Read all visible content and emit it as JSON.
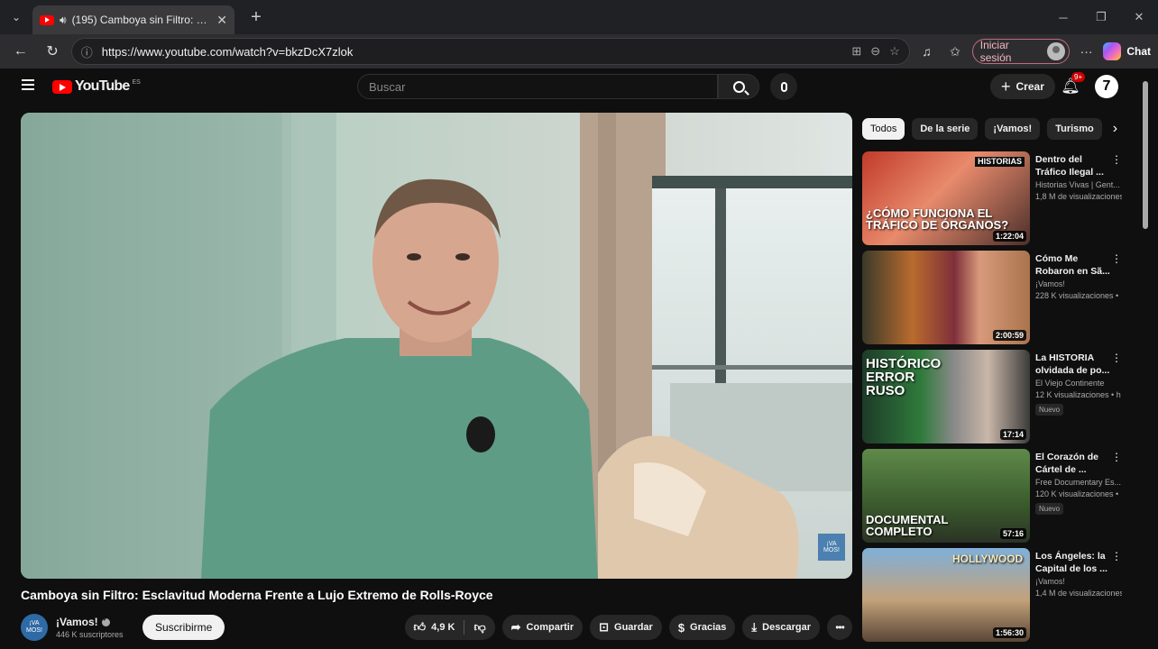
{
  "browser": {
    "tab_title": "(195) Camboya sin Filtro: Escla",
    "url": "https://www.youtube.com/watch?v=bkzDcX7zlok",
    "signin_label": "Iniciar sesión",
    "chat_label": "Chat"
  },
  "header": {
    "logo_text": "YouTube",
    "logo_country": "ES",
    "search_placeholder": "Buscar",
    "create_label": "Crear",
    "notif_count": "9+",
    "user_initial": "7"
  },
  "video": {
    "watermark": "¡VA MOS!",
    "title": "Camboya sin Filtro: Esclavitud Moderna Frente a Lujo Extremo de Rolls-Royce",
    "channel_avatar": "¡VA MOS!",
    "channel": "¡Vamos!",
    "subscribers": "446 K suscriptores",
    "subscribe_label": "Suscribirme",
    "likes": "4,9 K",
    "share_label": "Compartir",
    "save_label": "Guardar",
    "thanks_label": "Gracias",
    "download_label": "Descargar"
  },
  "chips": [
    "Todos",
    "De la serie",
    "¡Vamos!",
    "Turismo"
  ],
  "recommendations": [
    {
      "title": "Dentro del Tráfico Ilegal ...",
      "channel": "Historias Vivas | Gent...",
      "views": "1,8 M de visualizaciones",
      "duration": "1:22:04",
      "thumb_text": "¿CÓMO FUNCIONA EL TRÁFICO DE ÓRGANOS?",
      "thumb_top": "HISTORIAS",
      "badge": ""
    },
    {
      "title": "Cómo Me Robaron en Sã...",
      "channel": "¡Vamos!",
      "views": "228 K visualizaciones •",
      "duration": "2:00:59",
      "thumb_text": "",
      "thumb_top": "",
      "badge": ""
    },
    {
      "title": "La HISTORIA olvidada de po...",
      "channel": "El Viejo Continente",
      "views": "12 K visualizaciones • h",
      "duration": "17:14",
      "thumb_text": "HISTÓRICO ERROR RUSO",
      "thumb_top": "",
      "badge": "Nuevo"
    },
    {
      "title": "El Corazón de Cártel de ...",
      "channel": "Free Documentary Es...",
      "views": "120 K visualizaciones •",
      "duration": "57:16",
      "thumb_text": "DOCUMENTAL COMPLETO",
      "thumb_top": "",
      "badge": "Nuevo"
    },
    {
      "title": "Los Ángeles: la Capital de los ...",
      "channel": "¡Vamos!",
      "views": "1,4 M de visualizaciones",
      "duration": "1:56:30",
      "thumb_text": "HOLLYWOOD",
      "thumb_top": "",
      "badge": ""
    }
  ]
}
